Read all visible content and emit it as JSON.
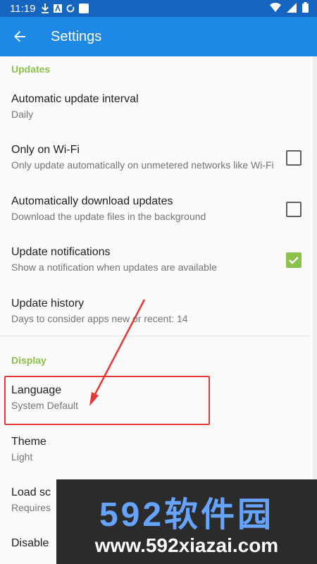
{
  "status_bar": {
    "time": "11:19"
  },
  "app_bar": {
    "title": "Settings"
  },
  "sections": {
    "updates": {
      "header": "Updates"
    },
    "display": {
      "header": "Display"
    }
  },
  "items": {
    "auto_update_interval": {
      "title": "Automatic update interval",
      "subtitle": "Daily"
    },
    "only_wifi": {
      "title": "Only on Wi-Fi",
      "subtitle": "Only update automatically on unmetered networks like Wi-Fi",
      "checked": false
    },
    "auto_download": {
      "title": "Automatically download updates",
      "subtitle": "Download the update files in the background",
      "checked": false
    },
    "update_notifications": {
      "title": "Update notifications",
      "subtitle": "Show a notification when updates are available",
      "checked": true
    },
    "update_history": {
      "title": "Update history",
      "subtitle": "Days to consider apps new or recent: 14"
    },
    "language": {
      "title": "Language",
      "subtitle": "System Default"
    },
    "theme": {
      "title": "Theme",
      "subtitle": "Light"
    },
    "load_screenshots": {
      "title": "Load sc",
      "subtitle": "Requires"
    },
    "disable": {
      "title": "Disable"
    }
  },
  "watermark": {
    "line1": "592软件园",
    "line2": "www.592xiazai.com"
  },
  "colors": {
    "primary": "#1e88e5",
    "primary_dark": "#1565c0",
    "accent": "#8bc34a",
    "highlight": "#e53935"
  }
}
